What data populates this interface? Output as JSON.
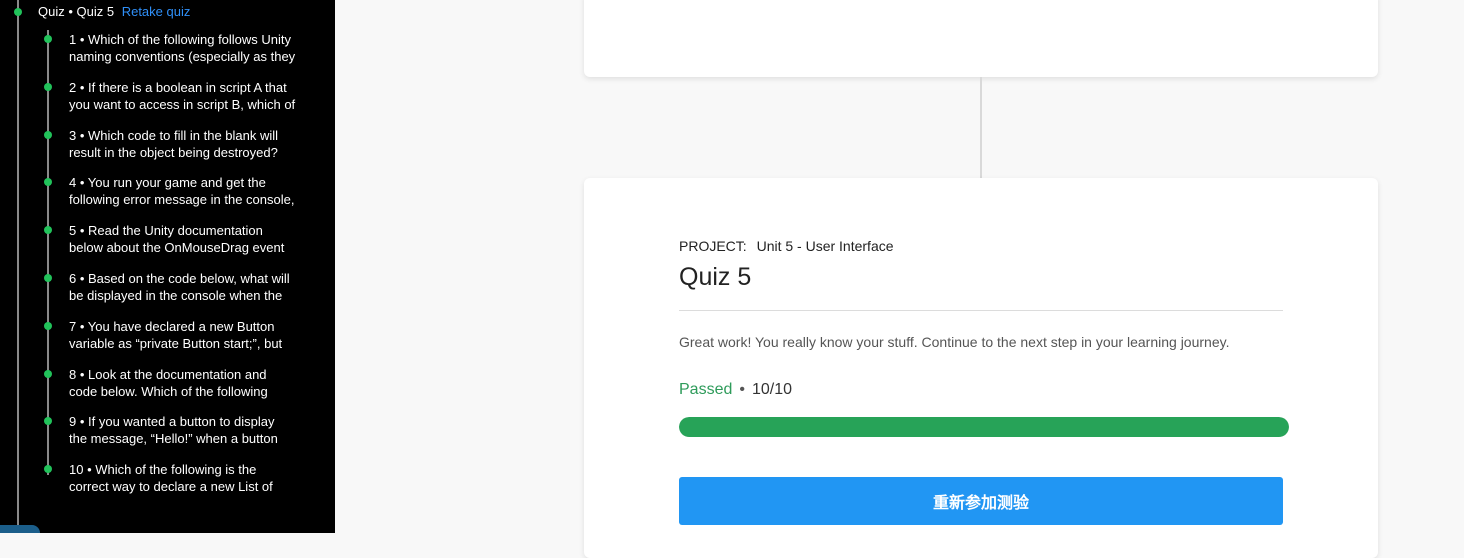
{
  "sidebar": {
    "quiz_prefix": "Quiz • Quiz 5",
    "retake_link": "Retake quiz",
    "questions": [
      {
        "line1": "1 • Which of the following follows Unity",
        "line2": "naming conventions (especially as they"
      },
      {
        "line1": "2 • If there is a boolean in script A that",
        "line2": "you want to access in script B, which of"
      },
      {
        "line1": "3 • Which code to fill in the blank will",
        "line2": "result in the object being destroyed?"
      },
      {
        "line1": "4 • You run your game and get the",
        "line2": "following error message in the console,"
      },
      {
        "line1": "5 • Read the Unity documentation",
        "line2": "below about the OnMouseDrag event"
      },
      {
        "line1": "6 • Based on the code below, what will",
        "line2": "be displayed in the console when the"
      },
      {
        "line1": "7 • You have declared a new Button",
        "line2": "variable as “private Button start;”, but"
      },
      {
        "line1": "8 • Look at the documentation and",
        "line2": "code below. Which of the following"
      },
      {
        "line1": "9 • If you wanted a button to display",
        "line2": "the message, “Hello!” when a button"
      },
      {
        "line1": "10 • Which of the following is the",
        "line2": "correct way to declare a new List of"
      }
    ]
  },
  "result": {
    "project_label": "PROJECT:",
    "project_name": "Unit 5 - User Interface",
    "title": "Quiz 5",
    "message": "Great work! You really know your stuff. Continue to the next step in your learning journey.",
    "status": "Passed",
    "separator": "•",
    "score": "10/10",
    "progress_fraction": 1.0,
    "button_label": "重新参加测验"
  },
  "colors": {
    "accent_green": "#27a358",
    "link_blue": "#2f8ff7",
    "button_blue": "#2196f3"
  }
}
